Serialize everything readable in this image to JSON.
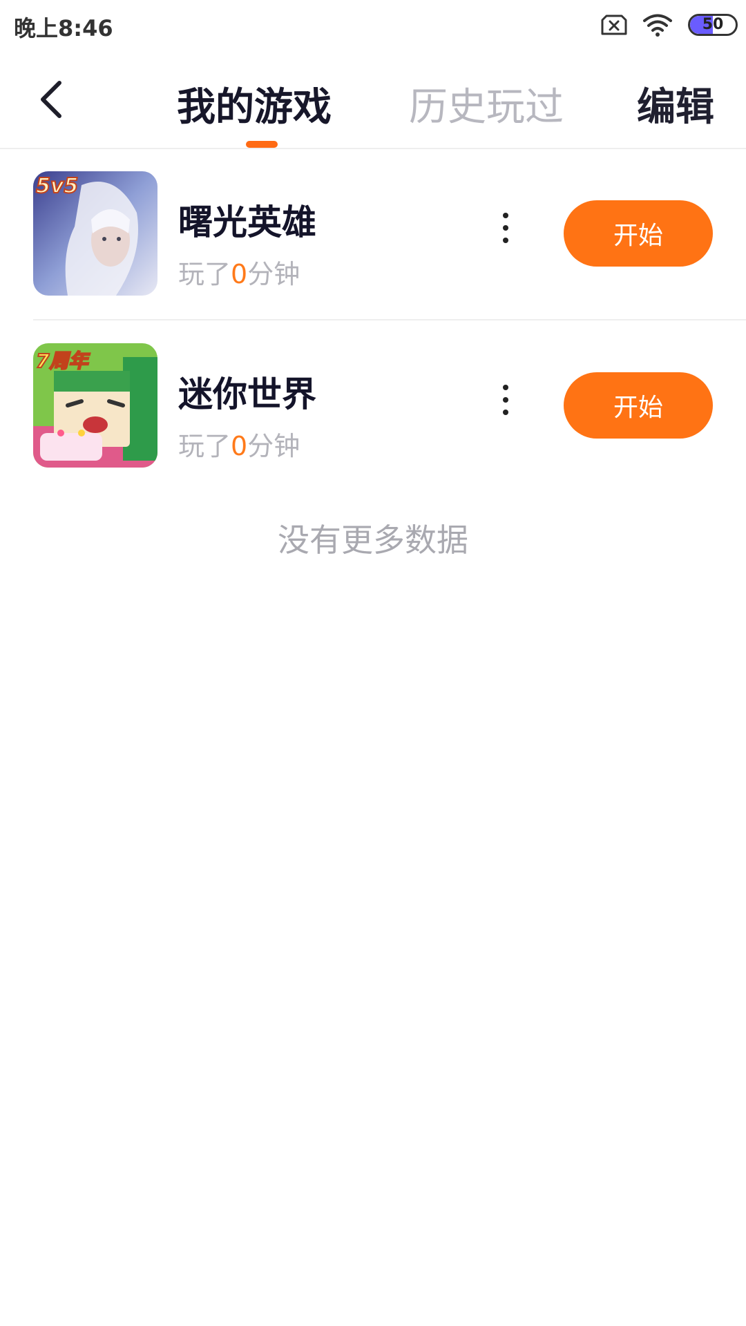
{
  "status": {
    "time": "晚上8:46",
    "battery": "50",
    "icons": [
      "sim-off-icon",
      "wifi-icon",
      "battery-icon"
    ],
    "battery_color": "#6a5cff"
  },
  "header": {
    "back_icon": "chevron-left-icon",
    "tabs": [
      {
        "label": "我的游戏",
        "active": true
      },
      {
        "label": "历史玩过",
        "active": false
      }
    ],
    "edit_label": "编辑",
    "accent": "#ff6a13"
  },
  "games": [
    {
      "title": "曙光英雄",
      "played_prefix": "玩了",
      "played_minutes": "0",
      "played_suffix": "分钟",
      "icon_badge": "5v5",
      "start_label": "开始"
    },
    {
      "title": "迷你世界",
      "played_prefix": "玩了",
      "played_minutes": "0",
      "played_suffix": "分钟",
      "icon_badge": "7周年",
      "start_label": "开始"
    }
  ],
  "footer": {
    "no_more": "没有更多数据"
  }
}
